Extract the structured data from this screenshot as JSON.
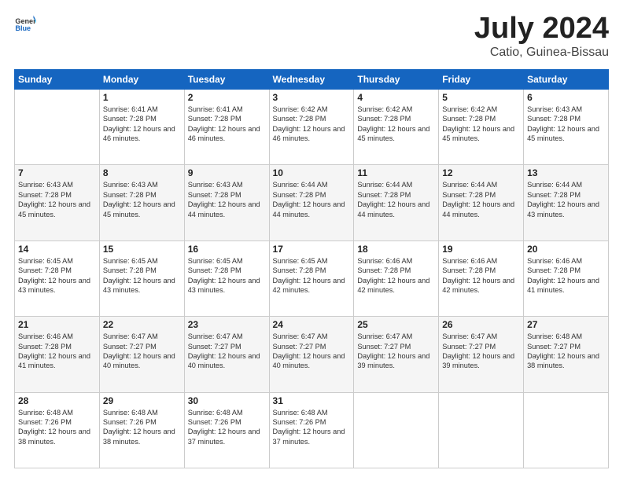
{
  "header": {
    "logo_general": "General",
    "logo_blue": "Blue",
    "title": "July 2024",
    "location": "Catio, Guinea-Bissau"
  },
  "days_of_week": [
    "Sunday",
    "Monday",
    "Tuesday",
    "Wednesday",
    "Thursday",
    "Friday",
    "Saturday"
  ],
  "weeks": [
    [
      {
        "day": "",
        "sunrise": "",
        "sunset": "",
        "daylight": ""
      },
      {
        "day": "1",
        "sunrise": "Sunrise: 6:41 AM",
        "sunset": "Sunset: 7:28 PM",
        "daylight": "Daylight: 12 hours and 46 minutes."
      },
      {
        "day": "2",
        "sunrise": "Sunrise: 6:41 AM",
        "sunset": "Sunset: 7:28 PM",
        "daylight": "Daylight: 12 hours and 46 minutes."
      },
      {
        "day": "3",
        "sunrise": "Sunrise: 6:42 AM",
        "sunset": "Sunset: 7:28 PM",
        "daylight": "Daylight: 12 hours and 46 minutes."
      },
      {
        "day": "4",
        "sunrise": "Sunrise: 6:42 AM",
        "sunset": "Sunset: 7:28 PM",
        "daylight": "Daylight: 12 hours and 45 minutes."
      },
      {
        "day": "5",
        "sunrise": "Sunrise: 6:42 AM",
        "sunset": "Sunset: 7:28 PM",
        "daylight": "Daylight: 12 hours and 45 minutes."
      },
      {
        "day": "6",
        "sunrise": "Sunrise: 6:43 AM",
        "sunset": "Sunset: 7:28 PM",
        "daylight": "Daylight: 12 hours and 45 minutes."
      }
    ],
    [
      {
        "day": "7",
        "sunrise": "Sunrise: 6:43 AM",
        "sunset": "Sunset: 7:28 PM",
        "daylight": "Daylight: 12 hours and 45 minutes."
      },
      {
        "day": "8",
        "sunrise": "Sunrise: 6:43 AM",
        "sunset": "Sunset: 7:28 PM",
        "daylight": "Daylight: 12 hours and 45 minutes."
      },
      {
        "day": "9",
        "sunrise": "Sunrise: 6:43 AM",
        "sunset": "Sunset: 7:28 PM",
        "daylight": "Daylight: 12 hours and 44 minutes."
      },
      {
        "day": "10",
        "sunrise": "Sunrise: 6:44 AM",
        "sunset": "Sunset: 7:28 PM",
        "daylight": "Daylight: 12 hours and 44 minutes."
      },
      {
        "day": "11",
        "sunrise": "Sunrise: 6:44 AM",
        "sunset": "Sunset: 7:28 PM",
        "daylight": "Daylight: 12 hours and 44 minutes."
      },
      {
        "day": "12",
        "sunrise": "Sunrise: 6:44 AM",
        "sunset": "Sunset: 7:28 PM",
        "daylight": "Daylight: 12 hours and 44 minutes."
      },
      {
        "day": "13",
        "sunrise": "Sunrise: 6:44 AM",
        "sunset": "Sunset: 7:28 PM",
        "daylight": "Daylight: 12 hours and 43 minutes."
      }
    ],
    [
      {
        "day": "14",
        "sunrise": "Sunrise: 6:45 AM",
        "sunset": "Sunset: 7:28 PM",
        "daylight": "Daylight: 12 hours and 43 minutes."
      },
      {
        "day": "15",
        "sunrise": "Sunrise: 6:45 AM",
        "sunset": "Sunset: 7:28 PM",
        "daylight": "Daylight: 12 hours and 43 minutes."
      },
      {
        "day": "16",
        "sunrise": "Sunrise: 6:45 AM",
        "sunset": "Sunset: 7:28 PM",
        "daylight": "Daylight: 12 hours and 43 minutes."
      },
      {
        "day": "17",
        "sunrise": "Sunrise: 6:45 AM",
        "sunset": "Sunset: 7:28 PM",
        "daylight": "Daylight: 12 hours and 42 minutes."
      },
      {
        "day": "18",
        "sunrise": "Sunrise: 6:46 AM",
        "sunset": "Sunset: 7:28 PM",
        "daylight": "Daylight: 12 hours and 42 minutes."
      },
      {
        "day": "19",
        "sunrise": "Sunrise: 6:46 AM",
        "sunset": "Sunset: 7:28 PM",
        "daylight": "Daylight: 12 hours and 42 minutes."
      },
      {
        "day": "20",
        "sunrise": "Sunrise: 6:46 AM",
        "sunset": "Sunset: 7:28 PM",
        "daylight": "Daylight: 12 hours and 41 minutes."
      }
    ],
    [
      {
        "day": "21",
        "sunrise": "Sunrise: 6:46 AM",
        "sunset": "Sunset: 7:28 PM",
        "daylight": "Daylight: 12 hours and 41 minutes."
      },
      {
        "day": "22",
        "sunrise": "Sunrise: 6:47 AM",
        "sunset": "Sunset: 7:27 PM",
        "daylight": "Daylight: 12 hours and 40 minutes."
      },
      {
        "day": "23",
        "sunrise": "Sunrise: 6:47 AM",
        "sunset": "Sunset: 7:27 PM",
        "daylight": "Daylight: 12 hours and 40 minutes."
      },
      {
        "day": "24",
        "sunrise": "Sunrise: 6:47 AM",
        "sunset": "Sunset: 7:27 PM",
        "daylight": "Daylight: 12 hours and 40 minutes."
      },
      {
        "day": "25",
        "sunrise": "Sunrise: 6:47 AM",
        "sunset": "Sunset: 7:27 PM",
        "daylight": "Daylight: 12 hours and 39 minutes."
      },
      {
        "day": "26",
        "sunrise": "Sunrise: 6:47 AM",
        "sunset": "Sunset: 7:27 PM",
        "daylight": "Daylight: 12 hours and 39 minutes."
      },
      {
        "day": "27",
        "sunrise": "Sunrise: 6:48 AM",
        "sunset": "Sunset: 7:27 PM",
        "daylight": "Daylight: 12 hours and 38 minutes."
      }
    ],
    [
      {
        "day": "28",
        "sunrise": "Sunrise: 6:48 AM",
        "sunset": "Sunset: 7:26 PM",
        "daylight": "Daylight: 12 hours and 38 minutes."
      },
      {
        "day": "29",
        "sunrise": "Sunrise: 6:48 AM",
        "sunset": "Sunset: 7:26 PM",
        "daylight": "Daylight: 12 hours and 38 minutes."
      },
      {
        "day": "30",
        "sunrise": "Sunrise: 6:48 AM",
        "sunset": "Sunset: 7:26 PM",
        "daylight": "Daylight: 12 hours and 37 minutes."
      },
      {
        "day": "31",
        "sunrise": "Sunrise: 6:48 AM",
        "sunset": "Sunset: 7:26 PM",
        "daylight": "Daylight: 12 hours and 37 minutes."
      },
      {
        "day": "",
        "sunrise": "",
        "sunset": "",
        "daylight": ""
      },
      {
        "day": "",
        "sunrise": "",
        "sunset": "",
        "daylight": ""
      },
      {
        "day": "",
        "sunrise": "",
        "sunset": "",
        "daylight": ""
      }
    ]
  ]
}
